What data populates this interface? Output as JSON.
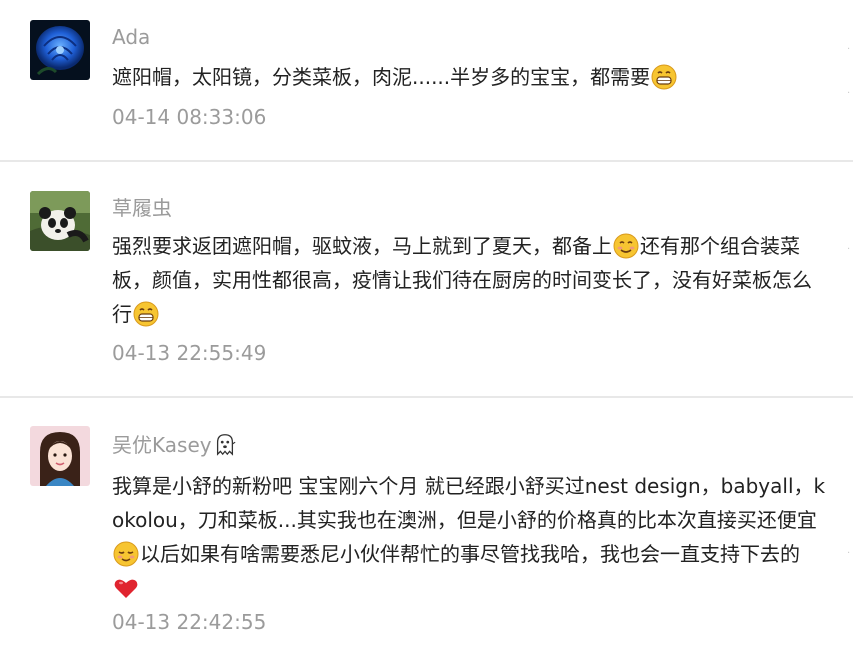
{
  "comments": [
    {
      "username": "Ada",
      "avatar": "blue-rose-avatar",
      "lines": [
        "遮阳帽，太阳镜，分类菜板，肉泥......半岁多的宝宝，都需要"
      ],
      "time": "04-14 08:33:06"
    },
    {
      "username": "草履虫",
      "avatar": "panda-avatar",
      "lines": [
        "强烈要求返团遮阳帽，驱蚊液，马上就到了夏天，都备上",
        "还有那个组合装菜",
        "板，颜值，实用性都很高，疫情让我们待在厨房的时间变长了，没有好菜板怎么",
        "行"
      ],
      "time": "04-13 22:55:49"
    },
    {
      "username": "吴优Kasey",
      "avatar": "girl-portrait-avatar",
      "lines": [
        "我算是小舒的新粉吧 宝宝刚六个月 就已经跟小舒买过nest design，babyall，k",
        "okolou，刀和菜板...其实我也在澳洲，但是小舒的价格真的比本次直接买还便宜",
        "以后如果有啥需要悉尼小伙伴帮忙的事尽管找我哈，我也会一直支持下去的"
      ],
      "time": "04-13 22:42:55"
    }
  ],
  "emoji_icons": {
    "grin": "grinning-face-icon",
    "smile": "smiling-face-icon",
    "relieved": "relieved-face-icon",
    "heart": "red-heart-icon",
    "ghost": "ghost-icon"
  },
  "colors": {
    "meta_text": "#9b9b9b",
    "body_text": "#222222",
    "divider": "#e8e8e8"
  }
}
